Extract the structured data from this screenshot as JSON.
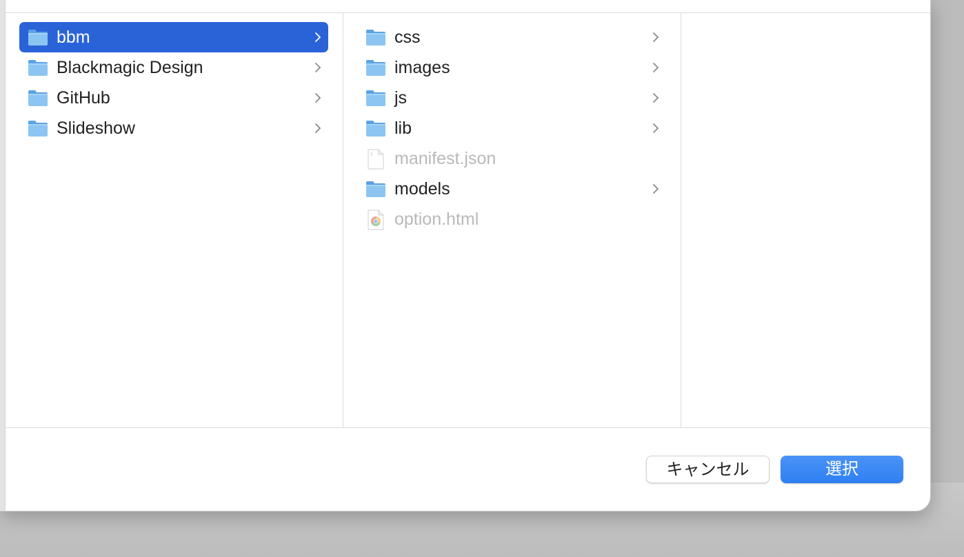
{
  "colors": {
    "accent": "#2a63d8",
    "folder": "#6fb2ea",
    "disabled_text": "#b9b9b9"
  },
  "columns": [
    {
      "items": [
        {
          "label": "bbm",
          "icon": "folder-icon",
          "selected": true,
          "has_children": true
        },
        {
          "label": "Blackmagic Design",
          "icon": "folder-icon",
          "has_children": true
        },
        {
          "label": "GitHub",
          "icon": "folder-icon",
          "has_children": true
        },
        {
          "label": "Slideshow",
          "icon": "folder-icon",
          "has_children": true
        }
      ]
    },
    {
      "items": [
        {
          "label": "css",
          "icon": "folder-icon",
          "has_children": true
        },
        {
          "label": "images",
          "icon": "folder-icon",
          "has_children": true
        },
        {
          "label": "js",
          "icon": "folder-icon",
          "has_children": true
        },
        {
          "label": "lib",
          "icon": "folder-icon",
          "has_children": true
        },
        {
          "label": "manifest.json",
          "icon": "document-icon",
          "disabled": true
        },
        {
          "label": "models",
          "icon": "folder-icon",
          "has_children": true
        },
        {
          "label": "option.html",
          "icon": "chrome-html-icon",
          "disabled": true
        }
      ]
    },
    {
      "items": []
    }
  ],
  "footer": {
    "cancel_label": "キャンセル",
    "choose_label": "選択"
  }
}
